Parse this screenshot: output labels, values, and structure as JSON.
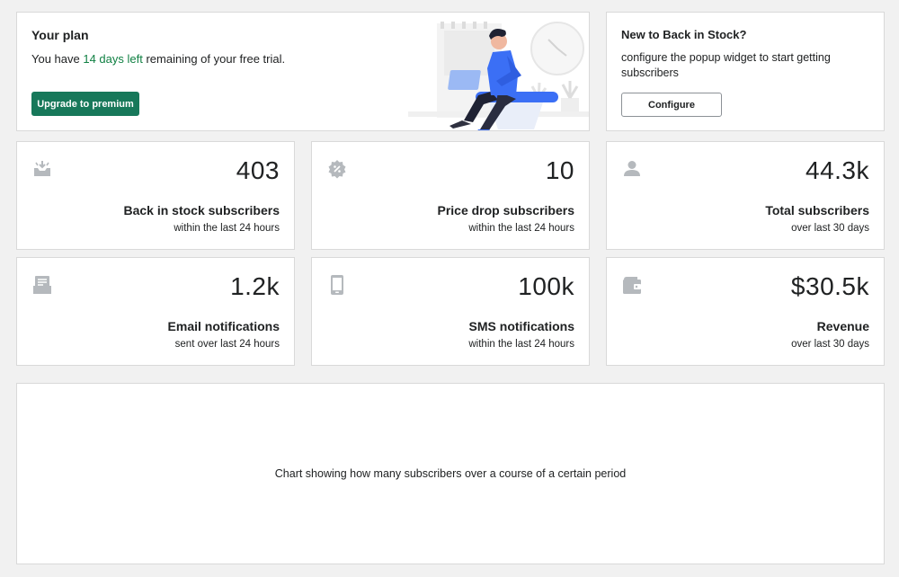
{
  "plan": {
    "title": "Your plan",
    "text_before": "You have ",
    "days_left": "14 days left",
    "text_after": " remaining of your free trial.",
    "upgrade_label": "Upgrade to premium"
  },
  "onboarding": {
    "title": "New to Back in Stock?",
    "text": "configure the popup widget to start getting subscribers",
    "configure_label": "Configure"
  },
  "stats": [
    {
      "icon": "inbox-arrow-icon",
      "value": "403",
      "label": "Back in stock subscribers",
      "sub": "within the last 24 hours"
    },
    {
      "icon": "discount-badge-icon",
      "value": "10",
      "label": "Price drop subscribers",
      "sub": "within the last 24 hours"
    },
    {
      "icon": "person-icon",
      "value": "44.3k",
      "label": "Total subscribers",
      "sub": "over last 30 days"
    },
    {
      "icon": "email-inbox-icon",
      "value": "1.2k",
      "label": "Email notifications",
      "sub": "sent over last 24 hours"
    },
    {
      "icon": "mobile-phone-icon",
      "value": "100k",
      "label": "SMS notifications",
      "sub": "within the last 24 hours"
    },
    {
      "icon": "wallet-icon",
      "value": "$30.5k",
      "label": "Revenue",
      "sub": "over last 30 days"
    }
  ],
  "chart_placeholder": "Chart showing how many subscribers over a course of a certain period",
  "colors": {
    "accent": "#17785a",
    "link_green": "#108043",
    "icon_gray": "#8c9196",
    "illustration_blue": "#3b6ff5"
  }
}
